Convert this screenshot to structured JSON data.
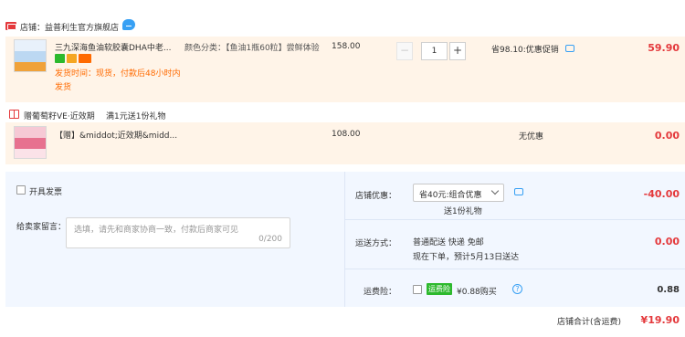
{
  "shop": {
    "name": "店铺：益普利生官方旗舰店"
  },
  "items": [
    {
      "title": "三九深海鱼油软胶囊DHA中老...",
      "ship_note": "发货时间：现货，付款后48小时内发货",
      "sku": "颜色分类：【鱼油1瓶60粒】尝鲜体验",
      "price": "158.00",
      "quantity": "1",
      "promo": "省98.10:优惠促销",
      "subtotal": "59.90"
    },
    {
      "title": "【赠】&middot;近效期&midd...",
      "price": "108.00",
      "promo": "无优惠",
      "subtotal": "0.00"
    }
  ],
  "gift": {
    "title": "赠葡萄籽VE·近效期",
    "rule": "满1元送1份礼物"
  },
  "invoice": {
    "label": "开具发票"
  },
  "message": {
    "label": "给卖家留言：",
    "placeholder": "选填，请先和商家协商一致，付款后商家可见",
    "counter": "0/200"
  },
  "coupon": {
    "label": "店铺优惠：",
    "selected": "省40元:组合优惠",
    "gift_note": "送1份礼物",
    "amount": "-40.00"
  },
  "shipping": {
    "label": "运送方式：",
    "method": "普通配送 快递 免邮",
    "eta": "现在下单，预计5月13日送达",
    "amount": "0.00"
  },
  "insurance": {
    "label": "运费险：",
    "badge": "运费险",
    "text": "¥0.88购买",
    "amount": "0.88"
  },
  "total": {
    "label": "店铺合计(含运费)",
    "amount": "¥19.90"
  },
  "colors": {
    "accent_red": "#e4393c",
    "item_bg": "#fff4e8",
    "panel_bg": "#f2f7ff",
    "link_blue": "#37a0f4"
  }
}
